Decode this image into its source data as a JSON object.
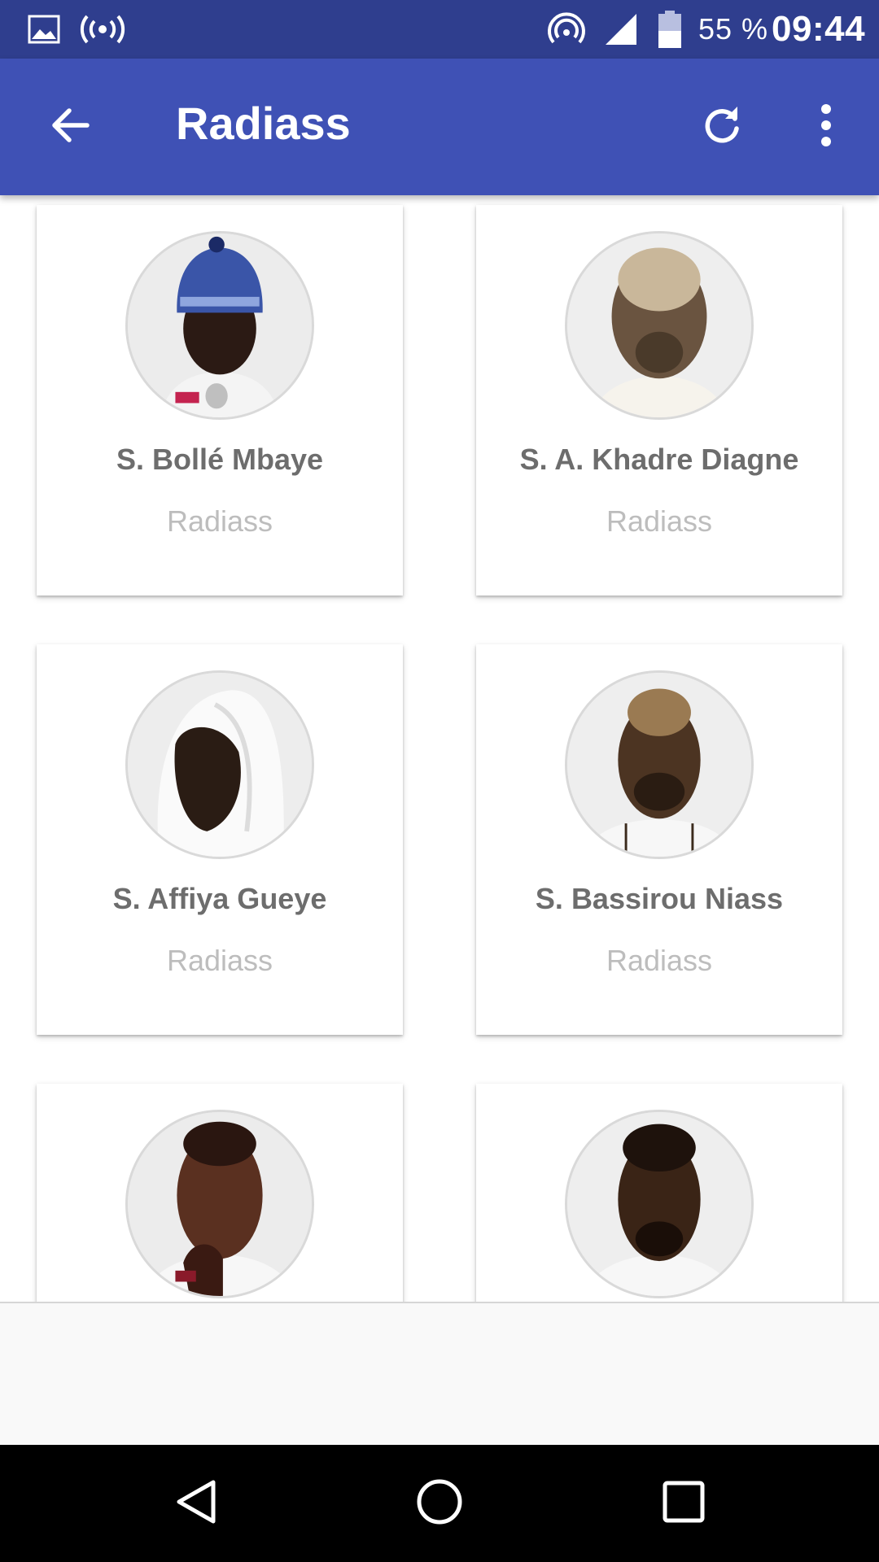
{
  "status_bar": {
    "battery_text": "55 %",
    "time": "09:44",
    "icons": [
      "gallery-icon",
      "hotspot-icon",
      "wifi-icon",
      "signal-icon",
      "battery-icon"
    ]
  },
  "app_bar": {
    "title": "Radiass",
    "icons": [
      "arrow-left-icon",
      "refresh-icon",
      "more-vert-icon"
    ],
    "color": "#3f51b5"
  },
  "cards": [
    {
      "name": "S. Bollé Mbaye",
      "subtitle": "Radiass",
      "avatar": "portrait-blue-hat"
    },
    {
      "name": "S. A. Khadre Diagne",
      "subtitle": "Radiass",
      "avatar": "portrait-bald"
    },
    {
      "name": "S. Affiya Gueye",
      "subtitle": "Radiass",
      "avatar": "portrait-white-headscarf"
    },
    {
      "name": "S. Bassirou Niass",
      "subtitle": "Radiass",
      "avatar": "portrait-bald"
    },
    {
      "name": "",
      "subtitle": "",
      "avatar": "portrait-hand-chin"
    },
    {
      "name": "",
      "subtitle": "",
      "avatar": "portrait-looking-down"
    }
  ],
  "nav_bar": {
    "icons": [
      "nav-back-icon",
      "nav-home-icon",
      "nav-recents-icon"
    ]
  },
  "colors": {
    "status_bar": "#2f3e8e",
    "app_bar": "#3f51b5",
    "card_name": "#6d6d6d",
    "card_subtitle": "#bdbdbd"
  }
}
